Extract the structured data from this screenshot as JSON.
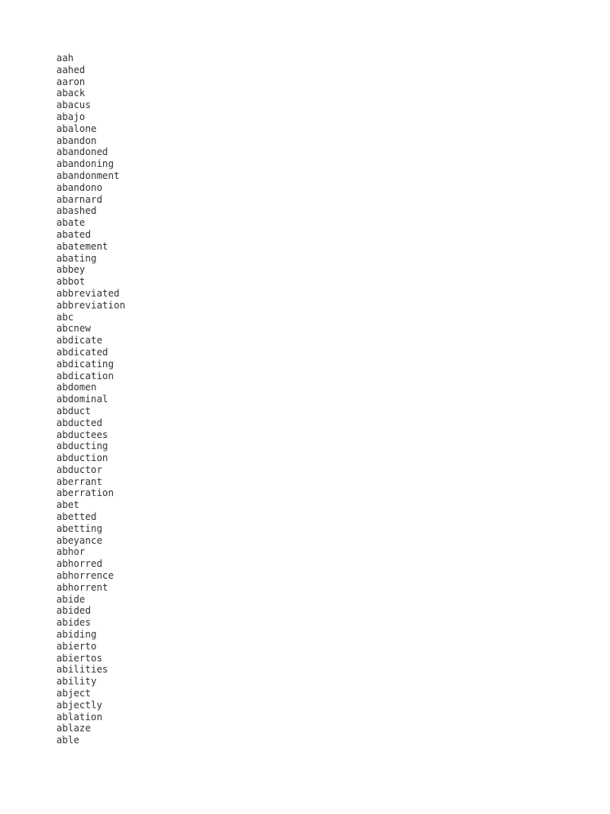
{
  "page": {
    "background_color": "#ffffff",
    "text_color": "#333333",
    "kind": "plain-text-word-list"
  },
  "word_list": {
    "name": "word-list",
    "count": 59,
    "items": [
      "aah",
      "aahed",
      "aaron",
      "aback",
      "abacus",
      "abajo",
      "abalone",
      "abandon",
      "abandoned",
      "abandoning",
      "abandonment",
      "abandono",
      "abarnard",
      "abashed",
      "abate",
      "abated",
      "abatement",
      "abating",
      "abbey",
      "abbot",
      "abbreviated",
      "abbreviation",
      "abc",
      "abcnew",
      "abdicate",
      "abdicated",
      "abdicating",
      "abdication",
      "abdomen",
      "abdominal",
      "abduct",
      "abducted",
      "abductees",
      "abducting",
      "abduction",
      "abductor",
      "aberrant",
      "aberration",
      "abet",
      "abetted",
      "abetting",
      "abeyance",
      "abhor",
      "abhorred",
      "abhorrence",
      "abhorrent",
      "abide",
      "abided",
      "abides",
      "abiding",
      "abierto",
      "abiertos",
      "abilities",
      "ability",
      "abject",
      "abjectly",
      "ablation",
      "ablaze",
      "able"
    ]
  }
}
